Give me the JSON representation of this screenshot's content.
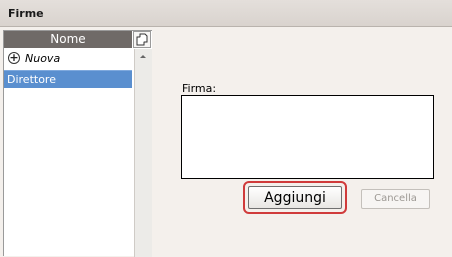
{
  "window": {
    "title": "Firme"
  },
  "list": {
    "column_header": "Nome",
    "copy_icon": "copy-icon",
    "new_item_icon": "plus-circle-icon",
    "new_item_label": "Nuova",
    "items": [
      {
        "label": "Direttore",
        "selected": true
      }
    ],
    "selection_color": "#5a8fcf"
  },
  "form": {
    "signature_label": "Firma:",
    "signature_value": ""
  },
  "buttons": {
    "add_label": "Aggiungi",
    "cancel_label": "Cancella",
    "cancel_enabled": false,
    "highlight_color": "#d03b3b"
  }
}
